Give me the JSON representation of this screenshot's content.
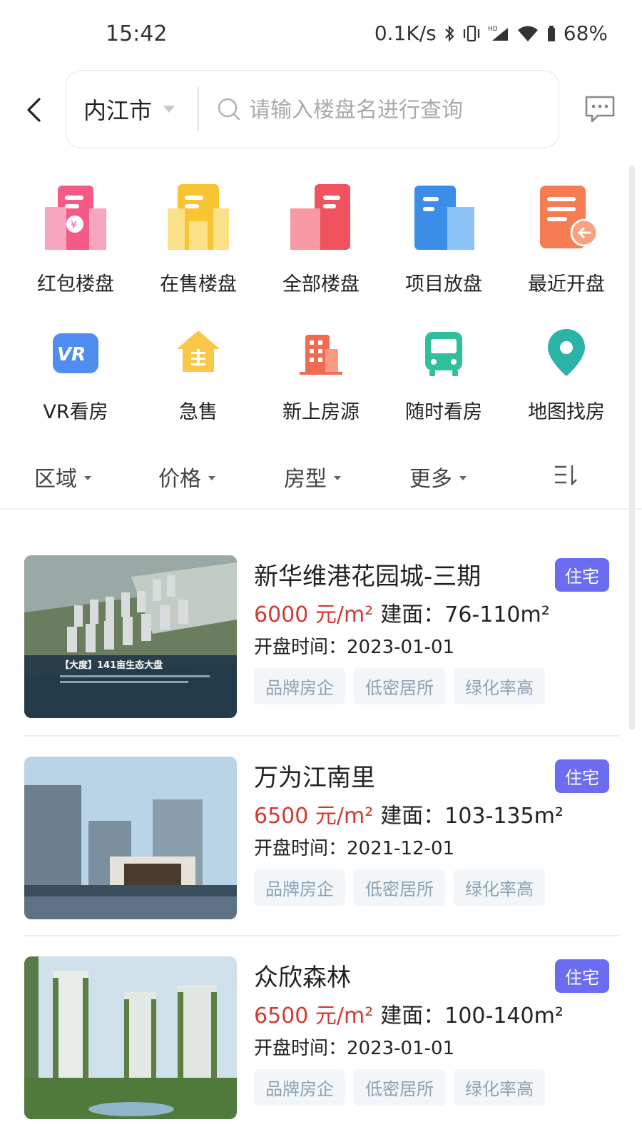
{
  "status_bar": {
    "time": "15:42",
    "network_speed": "0.1K/s",
    "battery": "68%",
    "icons": [
      "bluetooth-icon",
      "vibrate-icon",
      "hd-signal-icon",
      "wifi-icon",
      "battery-icon"
    ]
  },
  "header": {
    "city": "内江市",
    "search_placeholder": "请输入楼盘名进行查询",
    "icons": {
      "back": "back-arrow-icon",
      "message": "message-icon"
    }
  },
  "quick_menu": [
    {
      "label": "红包楼盘",
      "icon": "red-packet-building-icon",
      "color": "#f45a86"
    },
    {
      "label": "在售楼盘",
      "icon": "on-sale-building-icon",
      "color": "#f7c432"
    },
    {
      "label": "全部楼盘",
      "icon": "all-buildings-icon",
      "color": "#f0525f"
    },
    {
      "label": "项目放盘",
      "icon": "project-listing-icon",
      "color": "#3b8de8"
    },
    {
      "label": "最近开盘",
      "icon": "recent-opening-icon",
      "color": "#f67c52"
    },
    {
      "label": "VR看房",
      "icon": "vr-icon",
      "color": "#4f8ef0"
    },
    {
      "label": "急售",
      "icon": "urgent-sale-house-icon",
      "color": "#f9c74a"
    },
    {
      "label": "新上房源",
      "icon": "new-listing-building-icon",
      "color": "#f26a4f"
    },
    {
      "label": "随时看房",
      "icon": "bus-icon",
      "color": "#2fbf9a"
    },
    {
      "label": "地图找房",
      "icon": "map-pin-icon",
      "color": "#2cb3a7"
    }
  ],
  "filters": [
    {
      "label": "区域"
    },
    {
      "label": "价格"
    },
    {
      "label": "房型"
    },
    {
      "label": "更多"
    }
  ],
  "sort_icon": "sort-icon",
  "listings": [
    {
      "title": "新华维港花园城-三期",
      "badge": "住宅",
      "price": "6000 元/m²",
      "area": "建面：76-110m²",
      "date": "开盘时间：2023-01-01",
      "tags": [
        "品牌房企",
        "低密居所",
        "绿化率高"
      ],
      "image_caption": "【大度】141亩生态大盘"
    },
    {
      "title": "万为江南里",
      "badge": "住宅",
      "price": "6500 元/m²",
      "area": "建面：103-135m²",
      "date": "开盘时间：2021-12-01",
      "tags": [
        "品牌房企",
        "低密居所",
        "绿化率高"
      ]
    },
    {
      "title": "众欣森林",
      "badge": "住宅",
      "price": "6500 元/m²",
      "area": "建面：100-140m²",
      "date": "开盘时间：2023-01-01",
      "tags": [
        "品牌房企",
        "低密居所",
        "绿化率高"
      ]
    }
  ]
}
